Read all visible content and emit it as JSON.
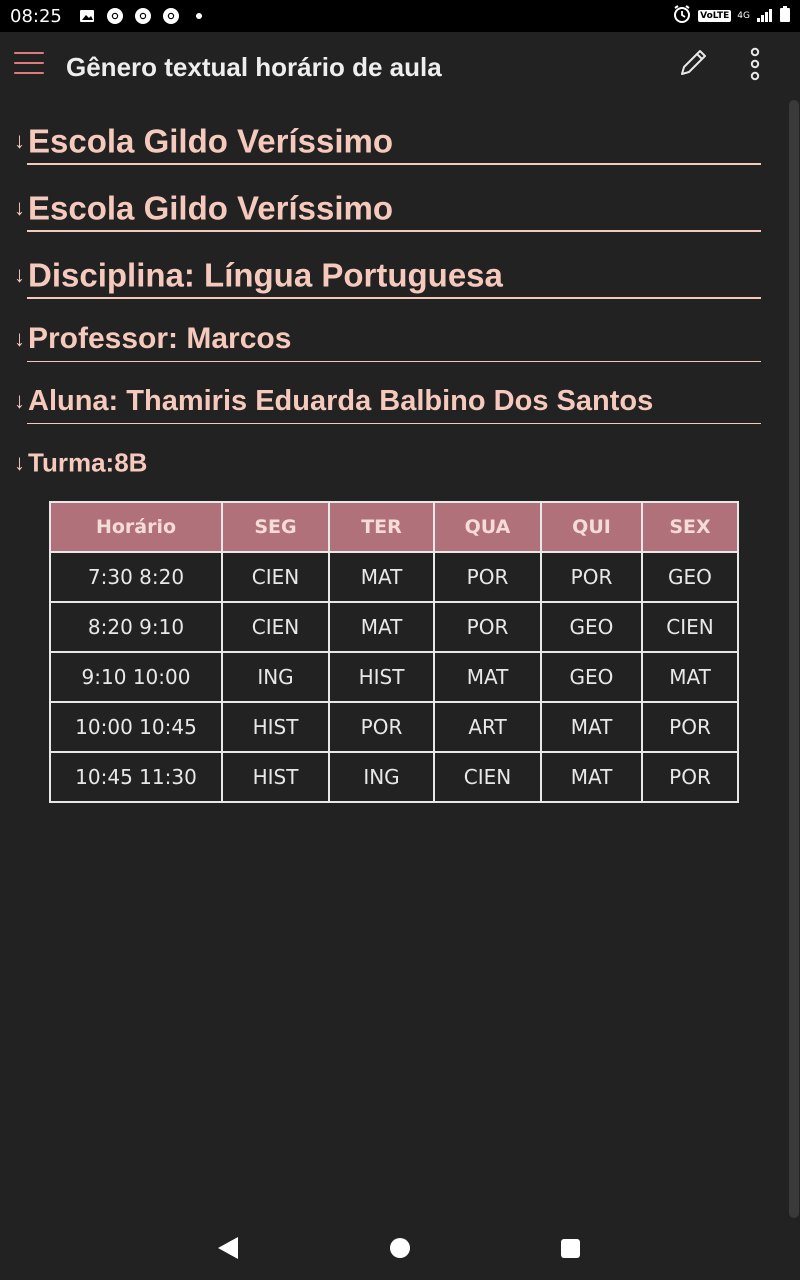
{
  "status_bar": {
    "time": "08:25",
    "left_icons": [
      "image-icon",
      "chrome-icon",
      "chrome-icon",
      "chrome-icon",
      "dot-icon"
    ],
    "volte": "VoLTE",
    "network": "4G"
  },
  "app_bar": {
    "title": "Gênero textual horário de aula"
  },
  "headings": [
    {
      "arrow": "↓",
      "text": "Escola Gildo Veríssimo"
    },
    {
      "arrow": "↓",
      "text": "Escola Gildo Veríssimo"
    },
    {
      "arrow": "↓",
      "text": "Disciplina: Língua Portuguesa"
    },
    {
      "arrow": "↓",
      "text": "Professor: Marcos"
    },
    {
      "arrow": "↓",
      "text": "Aluna: Thamiris Eduarda Balbino Dos Santos"
    },
    {
      "arrow": "↓",
      "text": "Turma:8B"
    }
  ],
  "table": {
    "headers": [
      "Horário",
      "SEG",
      "TER",
      "QUA",
      "QUI",
      "SEX"
    ],
    "rows": [
      [
        "7:30 8:20",
        "CIEN",
        "MAT",
        "POR",
        "POR",
        "GEO"
      ],
      [
        "8:20 9:10",
        "CIEN",
        "MAT",
        "POR",
        "GEO",
        "CIEN"
      ],
      [
        "9:10 10:00",
        "ING",
        "HIST",
        "MAT",
        "GEO",
        "MAT"
      ],
      [
        "10:00 10:45",
        "HIST",
        "POR",
        "ART",
        "MAT",
        "POR"
      ],
      [
        "10:45 11:30",
        "HIST",
        "ING",
        "CIEN",
        "MAT",
        "POR"
      ]
    ]
  },
  "colors": {
    "background": "#222222",
    "accent_text": "#f6c9bd",
    "table_header": "#b0717a",
    "menu_icon": "#e07a7a"
  }
}
